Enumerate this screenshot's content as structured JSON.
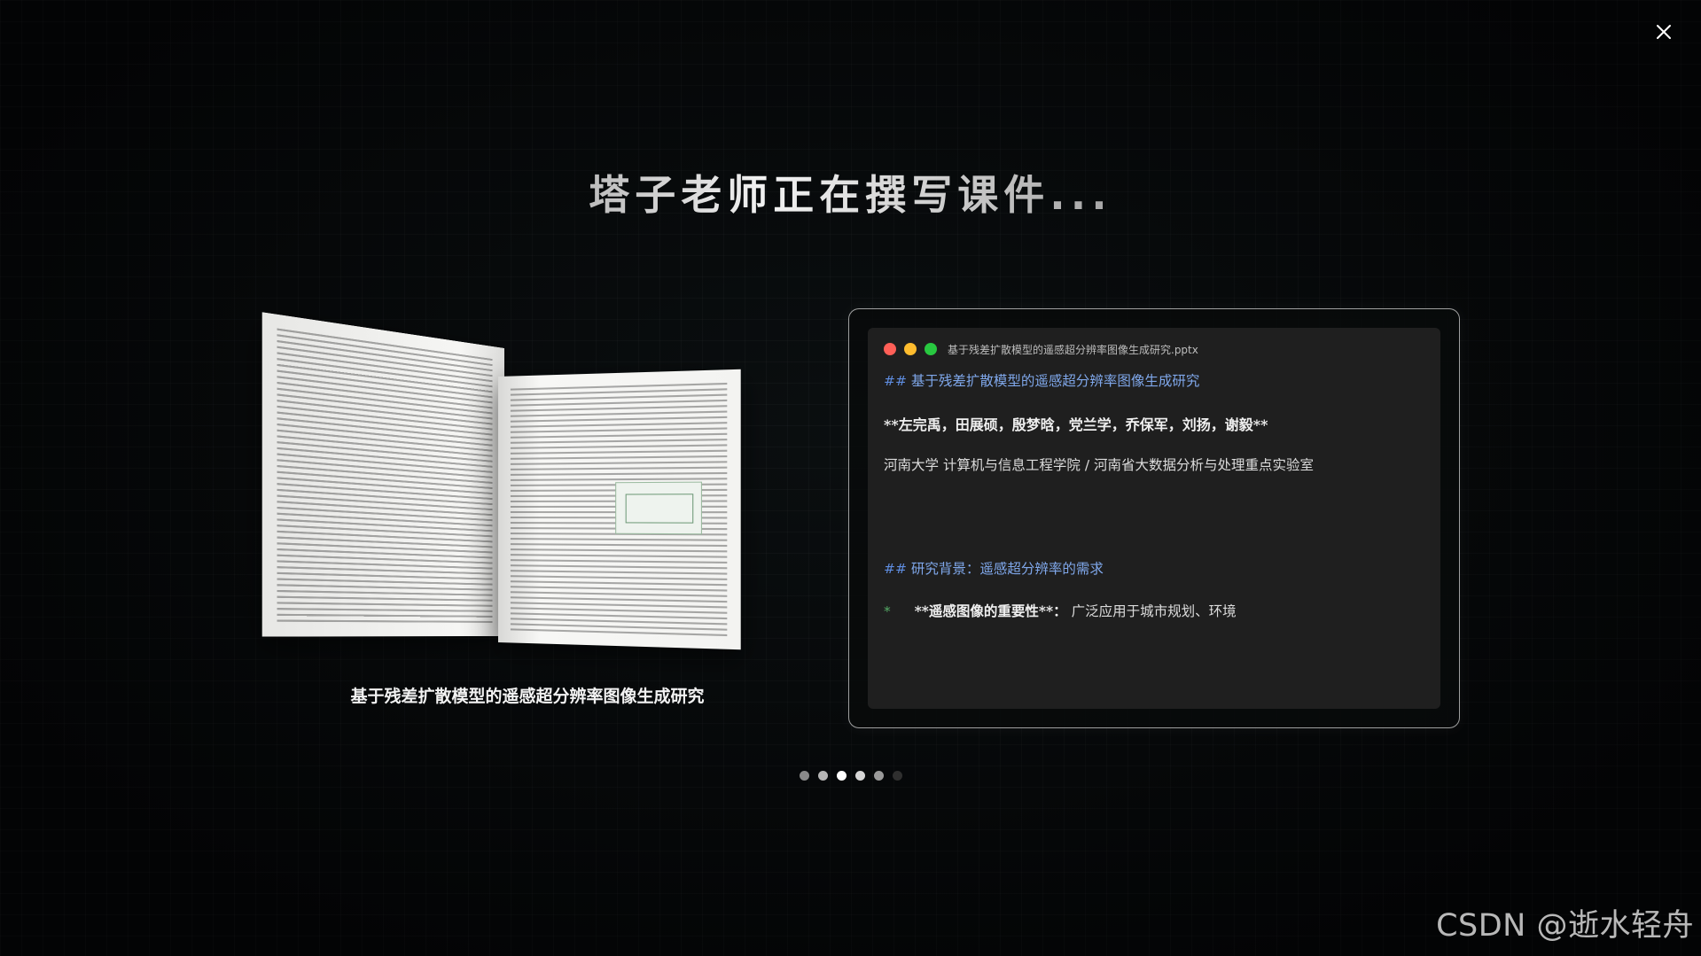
{
  "header": {
    "title": "塔子老师正在撰写课件..."
  },
  "close_icon": "close-icon",
  "book": {
    "caption": "基于残差扩散模型的遥感超分辨率图像生成研究"
  },
  "editor": {
    "file_name": "基于残差扩散模型的遥感超分辨率图像生成研究.pptx",
    "window_buttons": [
      {
        "name": "close",
        "color": "#ff5f57"
      },
      {
        "name": "minimize",
        "color": "#febc2e"
      },
      {
        "name": "maximize",
        "color": "#28c840"
      }
    ],
    "line1_hash": "##",
    "line1_text": "基于残差扩散模型的遥感超分辨率图像生成研究",
    "line2_text": "**左完禹，田展硕，殷梦晗，党兰学，乔保军，刘扬，谢毅**",
    "line3_text": "河南大学  计算机与信息工程学院  /  河南省大数据分析与处理重点实验室",
    "line4_hash": "##",
    "line4_text": "研究背景：遥感超分辨率的需求",
    "line5_star": "*",
    "line5_bold": "**遥感图像的重要性**：",
    "line5_text": "广泛应用于城市规划、环境"
  },
  "pagination": {
    "total": 6,
    "active_index": 2,
    "dots": [
      "#8a8a8a",
      "#b5b5b5",
      "#ffffff",
      "#d6d6d6",
      "#9a9a9a",
      "#2f2f2f"
    ]
  },
  "watermark": "CSDN @逝水轻舟"
}
